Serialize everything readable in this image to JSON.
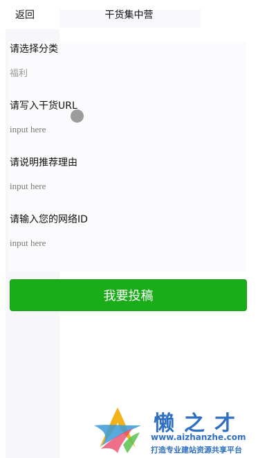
{
  "header": {
    "back_label": "返回",
    "title": "干货集中营"
  },
  "form": {
    "category": {
      "label": "请选择分类",
      "value": "福利"
    },
    "url": {
      "label": "请写入干货URL",
      "placeholder": "input here"
    },
    "reason": {
      "label": "请说明推荐理由",
      "placeholder": "input here"
    },
    "nickname": {
      "label": "请输入您的网络ID",
      "placeholder": "input here"
    }
  },
  "submit": {
    "label": "我要投稿",
    "color": "#1aad19"
  },
  "watermark": {
    "name": "懒之才",
    "url": "www.aizhanzhe.com",
    "tagline": "打造专业建站资源共享平台",
    "color": "#2f6fc2"
  }
}
